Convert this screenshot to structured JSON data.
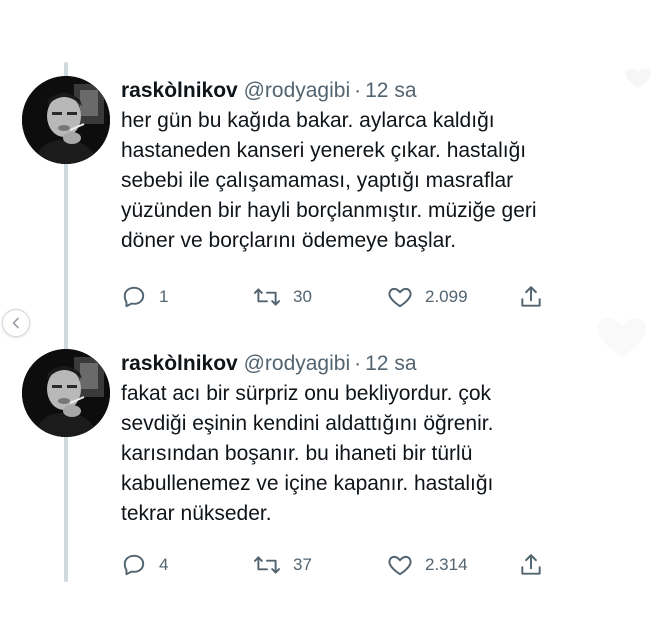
{
  "tweets": [
    {
      "name": "raskòlnikov",
      "handle": "@rodyagibi",
      "separator": "·",
      "time": "12 sa",
      "text_lines": [
        "her gün bu kağıda bakar. aylarca kaldığı",
        "hastaneden kanseri yenerek çıkar. hastalığı",
        "sebebi ile çalışamaması, yaptığı masraflar",
        "yüzünden bir hayli borçlanmıştır. müziğe geri",
        "döner ve borçlarını ödemeye başlar."
      ],
      "replies": "1",
      "retweets": "30",
      "likes": "2.099"
    },
    {
      "name": "raskòlnikov",
      "handle": "@rodyagibi",
      "separator": "·",
      "time": "12 sa",
      "text_lines": [
        "fakat acı bir sürpriz onu bekliyordur. çok",
        "sevdiği eşinin kendini aldattığını öğrenir.",
        "karısından boşanır. bu ihaneti bir türlü",
        "kabullenemez ve içine kapanır. hastalığı",
        "tekrar nükseder."
      ],
      "replies": "4",
      "retweets": "37",
      "likes": "2.314"
    }
  ],
  "icons": {
    "reply": "reply-icon",
    "retweet": "retweet-icon",
    "like": "heart-icon",
    "share": "share-icon",
    "carousel": "chevron-left-icon"
  },
  "colors": {
    "text": "#0f1419",
    "secondary": "#536471",
    "thread_line": "#cfd9de",
    "background": "#ffffff"
  }
}
